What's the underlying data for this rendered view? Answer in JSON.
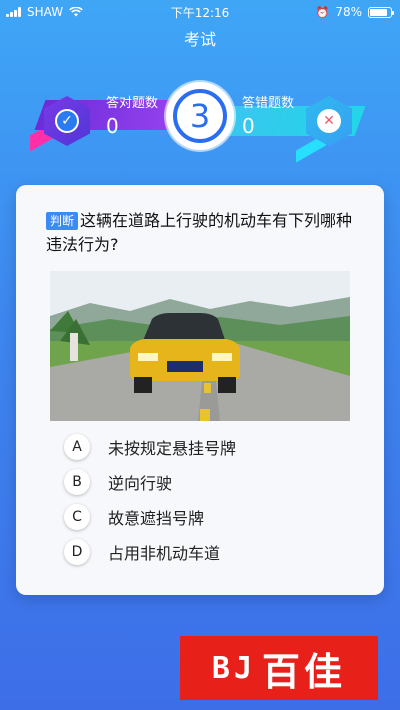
{
  "status_bar": {
    "carrier": "SHAW",
    "time": "下午12:16",
    "battery_percent": "78%",
    "battery_level": 0.78
  },
  "nav": {
    "title": "考试"
  },
  "score": {
    "correct_label": "答对题数",
    "correct_count": "0",
    "wrong_label": "答错题数",
    "wrong_count": "0",
    "current_question": "3"
  },
  "question": {
    "tag": "判断",
    "text": "这辆在道路上行驶的机动车有下列哪种违法行为?",
    "options": [
      {
        "letter": "A",
        "text": "未按规定悬挂号牌"
      },
      {
        "letter": "B",
        "text": "逆向行驶"
      },
      {
        "letter": "C",
        "text": "故意遮挡号牌"
      },
      {
        "letter": "D",
        "text": "占用非机动车道"
      }
    ]
  },
  "logo": {
    "text": "百佳"
  }
}
